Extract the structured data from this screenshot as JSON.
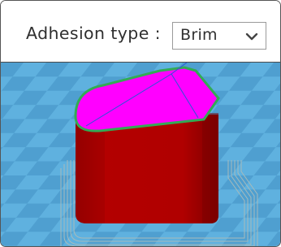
{
  "settings": {
    "adhesion_label": "Adhesion type :",
    "adhesion_value": "Brim",
    "dropdown_icon": "chevron-down-icon"
  },
  "viewport": {
    "icon": "3d-print-preview",
    "colors": {
      "floor_light": "#5fb1df",
      "floor_dark": "#4d9fcd",
      "model_wall": "#b00000",
      "model_wall_shadow": "#7e0000",
      "top_surface": "#ff00ff",
      "outline_green": "#44aa44",
      "infill_lines": "#2b55d8",
      "brim_lines": "#9ab0b0"
    }
  }
}
